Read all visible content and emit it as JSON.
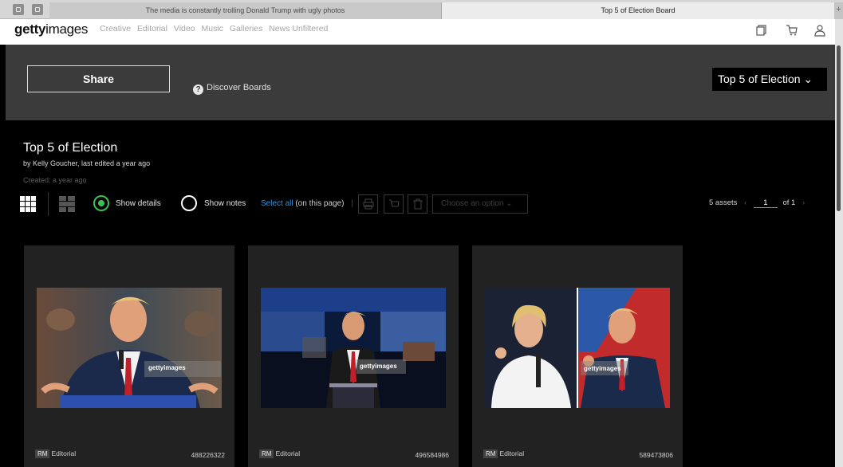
{
  "browser": {
    "tabs": [
      {
        "title": "The media is constantly trolling Donald Trump with ugly photos",
        "active": false
      },
      {
        "title": "Top 5 of Election Board",
        "active": true
      }
    ],
    "new_tab_label": "+"
  },
  "header": {
    "logo_bold": "getty",
    "logo_light": "images",
    "nav": [
      "Creative",
      "Editorial",
      "Video",
      "Music",
      "Galleries",
      "News Unfiltered"
    ],
    "icons": [
      "boards-icon",
      "cart-icon",
      "account-icon"
    ]
  },
  "band": {
    "share_label": "Share",
    "discover_icon": "?",
    "discover_label": "Discover Boards",
    "board_select_label": "Top 5 of Election",
    "board_select_chevron": "⌄"
  },
  "board": {
    "title": "Top 5 of Election",
    "byline": "by Kelly Goucher, last edited a year ago",
    "created": "Created: a year ago"
  },
  "toolbar": {
    "show_details_label": "Show details",
    "show_details_on": true,
    "show_notes_label": "Show notes",
    "show_notes_on": false,
    "select_all_link": "Select all",
    "select_all_suffix": " (on this page)",
    "separator": "|",
    "choose_option_placeholder": "Choose an option",
    "choose_option_chevron": "⌄",
    "asset_count": "5 assets",
    "prev_arrow": "‹",
    "current_page": "1",
    "page_of": "of 1",
    "next_arrow": "›"
  },
  "cards": [
    {
      "license": "RM",
      "type": "Editorial",
      "asset_id": "488226322",
      "watermark": "gettyimages"
    },
    {
      "license": "RM",
      "type": "Editorial",
      "asset_id": "496584986",
      "watermark": "gettyimages"
    },
    {
      "license": "RM",
      "type": "Editorial",
      "asset_id": "589473806",
      "watermark": "gettyimages"
    }
  ],
  "colors": {
    "accent_green": "#3fbf4f",
    "link_blue": "#3a8fd8",
    "band_gray": "#3b3b3b"
  }
}
